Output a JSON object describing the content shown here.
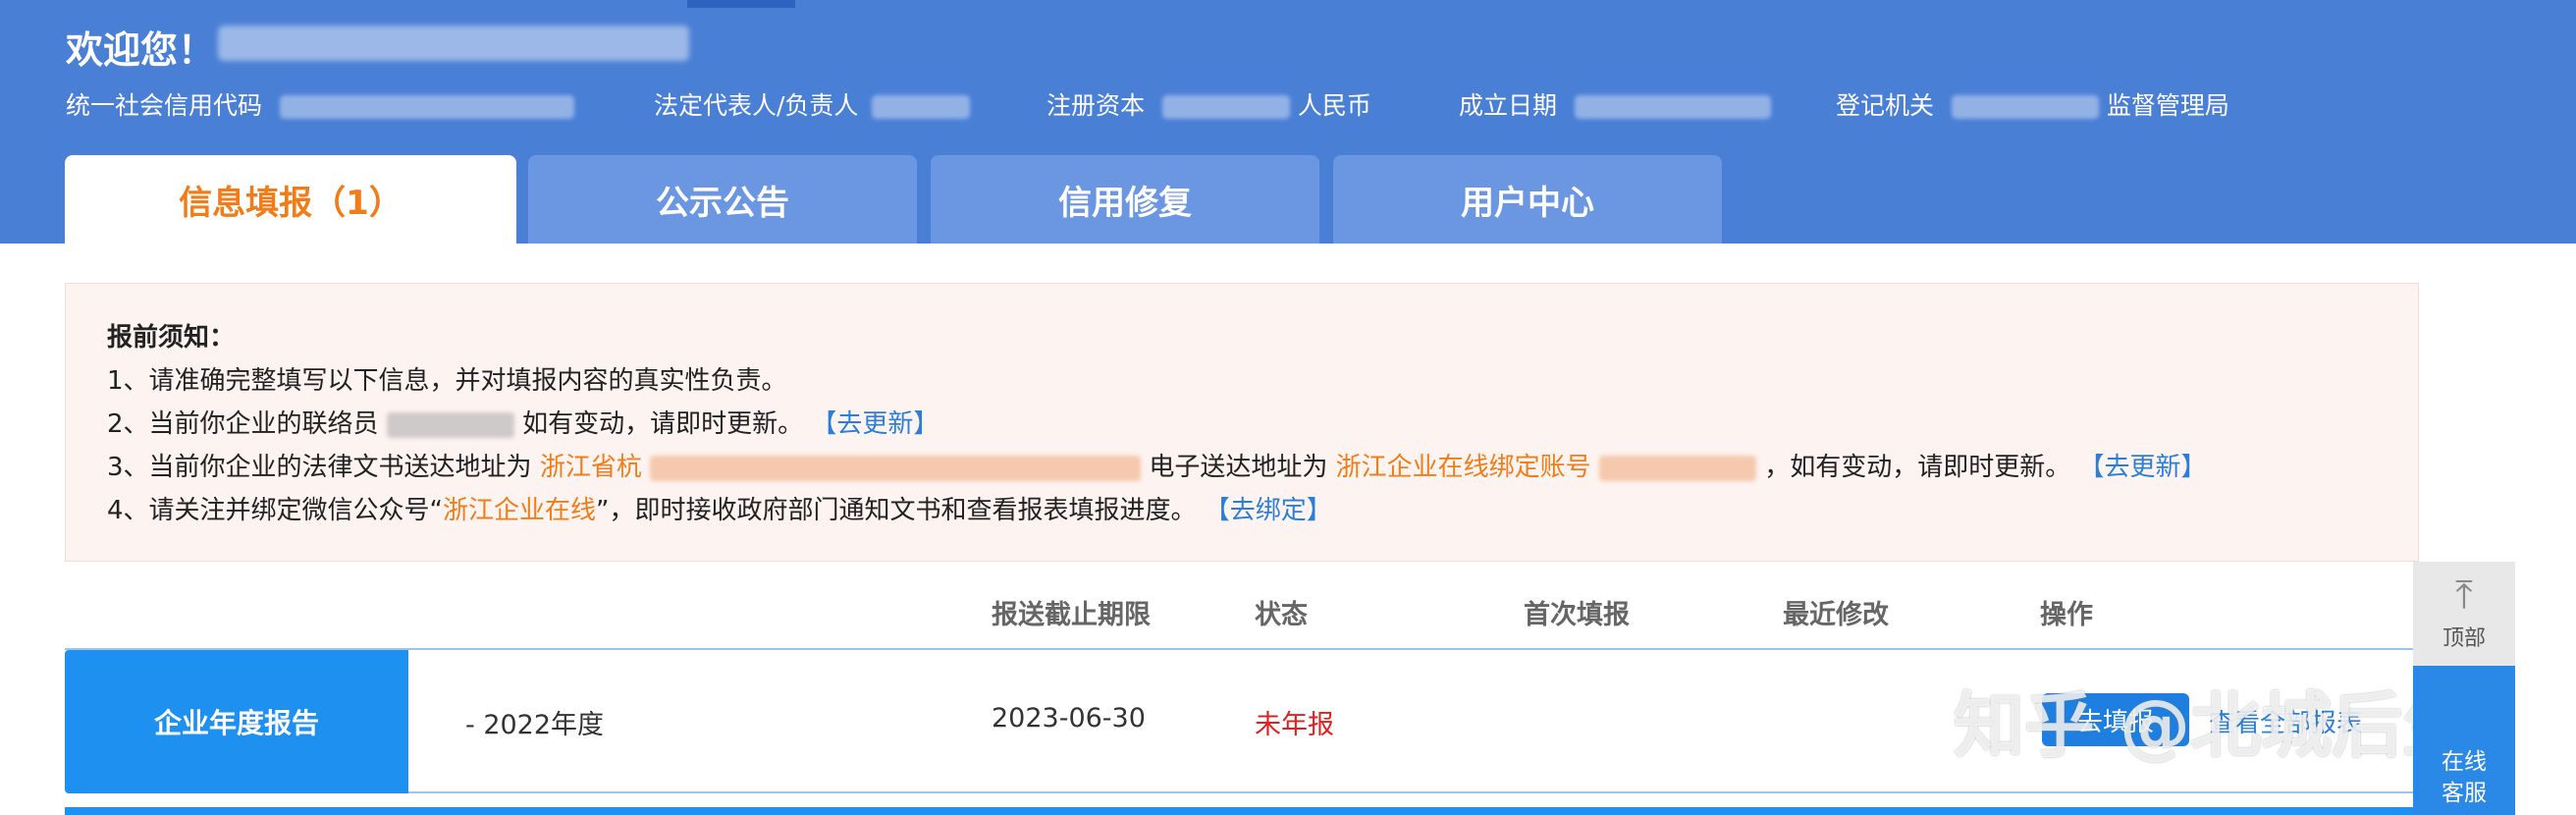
{
  "header": {
    "welcome": "欢迎您！",
    "info": {
      "credit_code_label": "统一社会信用代码",
      "legal_rep_label": "法定代表人/负责人",
      "capital_label": "注册资本",
      "capital_suffix": "人民币",
      "established_label": "成立日期",
      "registration_label": "登记机关",
      "registration_suffix": "监督管理局"
    }
  },
  "tabs": [
    {
      "label": "信息填报（1）",
      "active": true
    },
    {
      "label": "公示公告",
      "active": false
    },
    {
      "label": "信用修复",
      "active": false
    },
    {
      "label": "用户中心",
      "active": false
    }
  ],
  "notice": {
    "title": "报前须知：",
    "line1": "1、请准确完整填写以下信息，并对填报内容的真实性负责。",
    "line2_prefix": "2、当前你企业的联络员",
    "line2_suffix": "如有变动，请即时更新。",
    "line2_link": "【去更新】",
    "line3_prefix": "3、当前你企业的法律文书送达地址为",
    "line3_addr": "浙江省杭",
    "line3_mid": "电子送达地址为",
    "line3_account": "浙江企业在线绑定账号",
    "line3_suffix": "，如有变动，请即时更新。",
    "line3_link": "【去更新】",
    "line4_prefix": "4、请关注并绑定微信公众号“",
    "line4_account": "浙江企业在线",
    "line4_suffix": "”，即时接收政府部门通知文书和查看报表填报进度。",
    "line4_link": "【去绑定】"
  },
  "table": {
    "headers": [
      "报送截止期限",
      "状态",
      "首次填报",
      "最近修改",
      "操作"
    ],
    "rows": [
      {
        "category": "企业年度报告",
        "year": "- 2022年度",
        "deadline": "2023-06-30",
        "status": "未年报",
        "action_fill": "去填报",
        "action_all": "查看全部报表"
      }
    ]
  },
  "watermark": "知乎 @北城后生",
  "float": {
    "top_label": "顶部",
    "cs_label_1": "在线",
    "cs_label_2": "客服"
  },
  "colors": {
    "header_bg": "#4a7fd6",
    "tab_inactive": "#6b97e2",
    "accent_orange": "#f07d1a",
    "link_blue": "#2b7fd9",
    "status_red": "#e02020",
    "row_label_bg": "#1e90f0"
  },
  "icons": {
    "back_to_top": "arrow-up-icon"
  }
}
